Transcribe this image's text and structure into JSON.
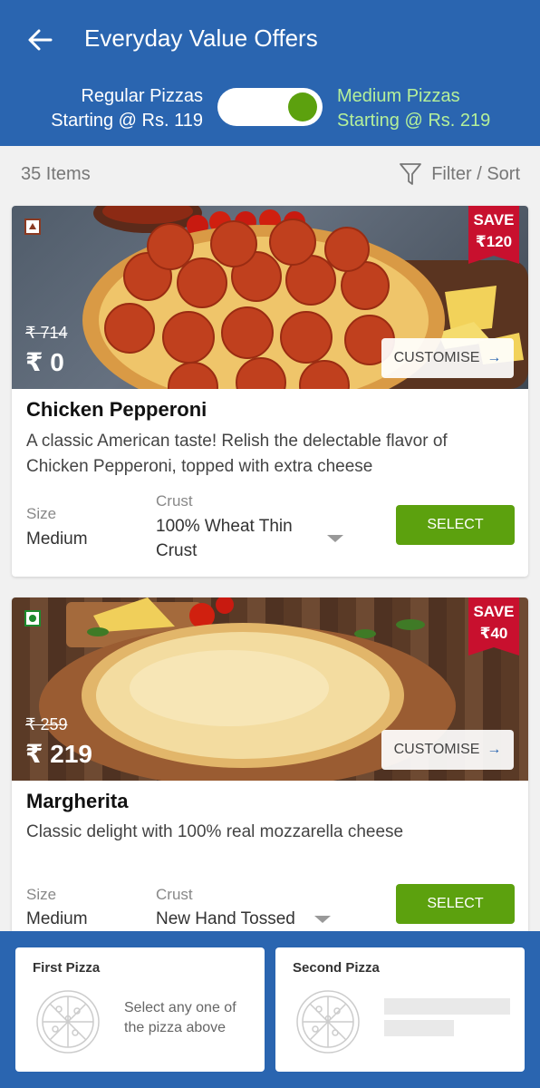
{
  "header": {
    "title": "Everyday Value Offers",
    "toggle_left": [
      "Regular Pizzas",
      "Starting @ Rs. 119"
    ],
    "toggle_right": [
      "Medium Pizzas",
      "Starting @ Rs. 219"
    ],
    "toggle_on": true
  },
  "toolbar": {
    "count": "35 Items",
    "filter_label": "Filter / Sort"
  },
  "items": [
    {
      "name": "Chicken Pepperoni",
      "description": "A classic American taste! Relish the delectable flavor of Chicken Pepperoni, topped with extra cheese",
      "veg": false,
      "save": [
        "SAVE",
        "₹120"
      ],
      "old_price": "₹ 714",
      "price": "₹ 0",
      "customise": "CUSTOMISE",
      "size_label": "Size",
      "size": "Medium",
      "crust_label": "Crust",
      "crust": "100% Wheat Thin Crust",
      "select": "SELECT"
    },
    {
      "name": "Margherita",
      "description": "Classic delight with 100% real mozzarella cheese",
      "veg": true,
      "save": [
        "SAVE",
        "₹40"
      ],
      "old_price": "₹ 259",
      "price": "₹ 219",
      "customise": "CUSTOMISE",
      "size_label": "Size",
      "size": "Medium",
      "crust_label": "Crust",
      "crust": "New Hand Tossed",
      "select": "SELECT"
    }
  ],
  "bottom": {
    "first_title": "First Pizza",
    "first_hint": "Select any one of the pizza above",
    "second_title": "Second Pizza"
  },
  "colors": {
    "brand_blue": "#2a65b0",
    "accent_green": "#5ca10e",
    "save_red": "#c8102e"
  }
}
